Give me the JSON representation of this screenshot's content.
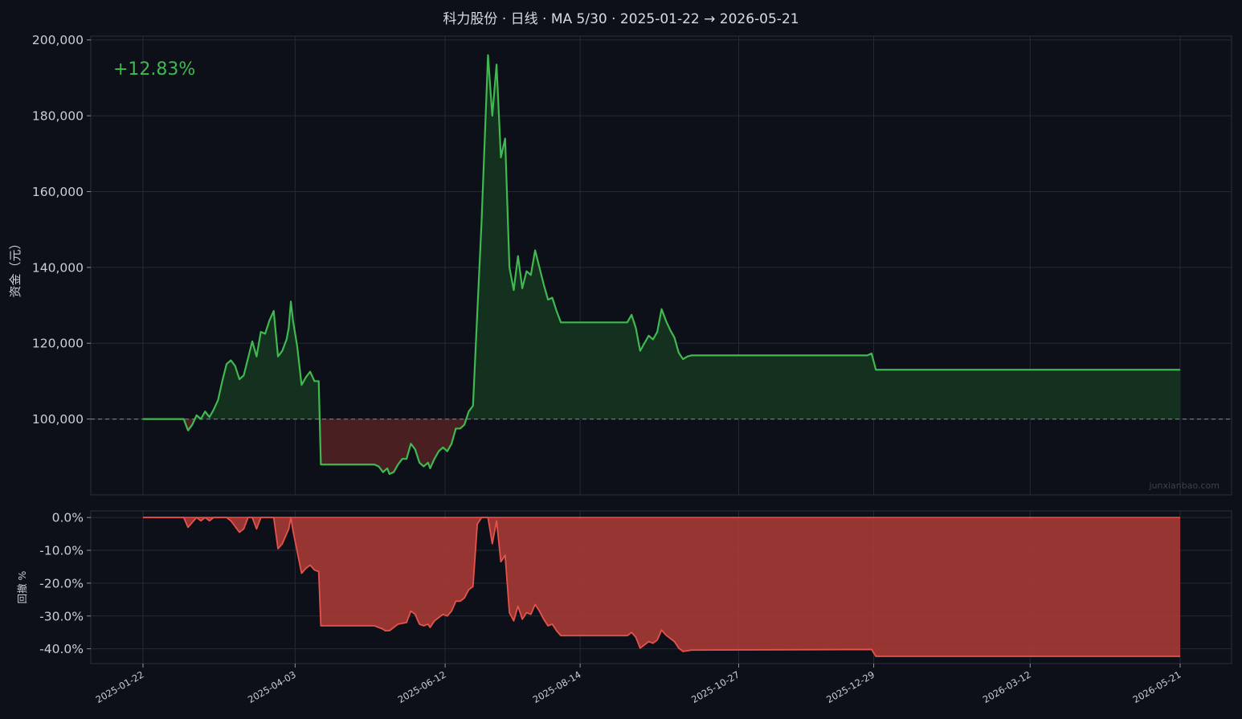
{
  "title": "科力股份 · 日线 · MA 5/30 · 2025-01-22 → 2026-05-21",
  "watermark": "junxianbao.com",
  "return_label": "+12.83%",
  "colors": {
    "background": "#0d1018",
    "panel": "#0d1018",
    "grid": "#252a34",
    "equity_line": "#3fb950",
    "equity_fill_up": "#14301f",
    "equity_fill_down": "#4a1f22",
    "drawdown_line": "#e5534b",
    "drawdown_fill": "#a63a36",
    "baseline": "#6e7681",
    "return_text": "#3fb950"
  },
  "chart_data": [
    {
      "type": "area",
      "name": "equity",
      "ylabel": "资金（元）",
      "ylim": [
        80000,
        201000
      ],
      "yticks": [
        100000,
        120000,
        140000,
        160000,
        180000,
        200000
      ],
      "ytick_labels": [
        "100,000",
        "120,000",
        "140,000",
        "160,000",
        "180,000",
        "200,000"
      ],
      "baseline": 100000,
      "grid": true,
      "x_start": "2025-01-22",
      "x_end": "2026-05-21",
      "xticks": [
        "2025-01-22",
        "2025-04-03",
        "2025-06-12",
        "2025-08-14",
        "2025-10-27",
        "2025-12-29",
        "2026-03-12",
        "2026-05-21"
      ],
      "points": [
        [
          "2025-01-22",
          100000
        ],
        [
          "2025-01-30",
          100000
        ],
        [
          "2025-02-07",
          100000
        ],
        [
          "2025-02-10",
          100000
        ],
        [
          "2025-02-12",
          97000
        ],
        [
          "2025-02-14",
          98500
        ],
        [
          "2025-02-16",
          101000
        ],
        [
          "2025-02-18",
          100000
        ],
        [
          "2025-02-20",
          102000
        ],
        [
          "2025-02-22",
          100500
        ],
        [
          "2025-02-24",
          102500
        ],
        [
          "2025-02-26",
          105000
        ],
        [
          "2025-02-28",
          110000
        ],
        [
          "2025-03-02",
          114500
        ],
        [
          "2025-03-04",
          115500
        ],
        [
          "2025-03-06",
          114000
        ],
        [
          "2025-03-08",
          110500
        ],
        [
          "2025-03-10",
          111500
        ],
        [
          "2025-03-12",
          116000
        ],
        [
          "2025-03-14",
          120500
        ],
        [
          "2025-03-16",
          116500
        ],
        [
          "2025-03-18",
          123000
        ],
        [
          "2025-03-20",
          122500
        ],
        [
          "2025-03-22",
          126000
        ],
        [
          "2025-03-24",
          128500
        ],
        [
          "2025-03-26",
          116500
        ],
        [
          "2025-03-28",
          118000
        ],
        [
          "2025-03-30",
          121000
        ],
        [
          "2025-03-31",
          124000
        ],
        [
          "2025-04-01",
          131000
        ],
        [
          "2025-04-02",
          126000
        ],
        [
          "2025-04-04",
          119000
        ],
        [
          "2025-04-06",
          109000
        ],
        [
          "2025-04-08",
          111000
        ],
        [
          "2025-04-10",
          112500
        ],
        [
          "2025-04-12",
          110000
        ],
        [
          "2025-04-14",
          110000
        ],
        [
          "2025-04-15",
          88000
        ],
        [
          "2025-04-20",
          88000
        ],
        [
          "2025-05-01",
          88000
        ],
        [
          "2025-05-10",
          88000
        ],
        [
          "2025-05-12",
          87500
        ],
        [
          "2025-05-14",
          86000
        ],
        [
          "2025-05-16",
          87000
        ],
        [
          "2025-05-17",
          85500
        ],
        [
          "2025-05-19",
          86000
        ],
        [
          "2025-05-21",
          88000
        ],
        [
          "2025-05-23",
          89500
        ],
        [
          "2025-05-25",
          89500
        ],
        [
          "2025-05-27",
          93500
        ],
        [
          "2025-05-29",
          92000
        ],
        [
          "2025-05-31",
          88500
        ],
        [
          "2025-06-02",
          87500
        ],
        [
          "2025-06-04",
          88500
        ],
        [
          "2025-06-05",
          87000
        ],
        [
          "2025-06-07",
          89500
        ],
        [
          "2025-06-09",
          91500
        ],
        [
          "2025-06-11",
          92500
        ],
        [
          "2025-06-13",
          91500
        ],
        [
          "2025-06-15",
          93500
        ],
        [
          "2025-06-17",
          97500
        ],
        [
          "2025-06-19",
          97500
        ],
        [
          "2025-06-21",
          98500
        ],
        [
          "2025-06-23",
          102000
        ],
        [
          "2025-06-25",
          103500
        ],
        [
          "2025-06-27",
          128000
        ],
        [
          "2025-06-29",
          152000
        ],
        [
          "2025-07-02",
          196000
        ],
        [
          "2025-07-04",
          180000
        ],
        [
          "2025-07-06",
          193500
        ],
        [
          "2025-07-08",
          169000
        ],
        [
          "2025-07-10",
          174000
        ],
        [
          "2025-07-12",
          140000
        ],
        [
          "2025-07-14",
          134000
        ],
        [
          "2025-07-16",
          143000
        ],
        [
          "2025-07-18",
          134500
        ],
        [
          "2025-07-20",
          139000
        ],
        [
          "2025-07-22",
          138000
        ],
        [
          "2025-07-24",
          144500
        ],
        [
          "2025-07-26",
          140000
        ],
        [
          "2025-07-28",
          135500
        ],
        [
          "2025-07-30",
          131500
        ],
        [
          "2025-08-01",
          132000
        ],
        [
          "2025-08-03",
          128500
        ],
        [
          "2025-08-05",
          125500
        ],
        [
          "2025-08-10",
          125500
        ],
        [
          "2025-08-20",
          125500
        ],
        [
          "2025-09-01",
          125500
        ],
        [
          "2025-09-05",
          125500
        ],
        [
          "2025-09-07",
          127500
        ],
        [
          "2025-09-09",
          124000
        ],
        [
          "2025-09-11",
          118000
        ],
        [
          "2025-09-13",
          120000
        ],
        [
          "2025-09-15",
          122000
        ],
        [
          "2025-09-17",
          121000
        ],
        [
          "2025-09-19",
          123000
        ],
        [
          "2025-09-21",
          129000
        ],
        [
          "2025-09-23",
          126000
        ],
        [
          "2025-09-25",
          123500
        ],
        [
          "2025-09-27",
          121500
        ],
        [
          "2025-09-29",
          117500
        ],
        [
          "2025-10-01",
          115800
        ],
        [
          "2025-10-03",
          116500
        ],
        [
          "2025-10-05",
          116800
        ],
        [
          "2025-10-15",
          116800
        ],
        [
          "2025-11-01",
          116800
        ],
        [
          "2025-11-20",
          116800
        ],
        [
          "2025-12-10",
          116800
        ],
        [
          "2025-12-26",
          116800
        ],
        [
          "2025-12-28",
          117300
        ],
        [
          "2025-12-30",
          113000
        ],
        [
          "2026-01-15",
          113000
        ],
        [
          "2026-02-10",
          113000
        ],
        [
          "2026-03-10",
          113000
        ],
        [
          "2026-04-10",
          113000
        ],
        [
          "2026-05-21",
          113000
        ]
      ]
    },
    {
      "type": "area",
      "name": "drawdown",
      "ylabel": "回撤 %",
      "ylim": [
        -44.5,
        2
      ],
      "yticks": [
        0,
        -10,
        -20,
        -30,
        -40
      ],
      "ytick_labels": [
        "0.0%",
        "-10.0%",
        "-20.0%",
        "-30.0%",
        "-40.0%"
      ],
      "grid": true,
      "x_start": "2025-01-22",
      "x_end": "2026-05-21",
      "xticks": [
        "2025-01-22",
        "2025-04-03",
        "2025-06-12",
        "2025-08-14",
        "2025-10-27",
        "2025-12-29",
        "2026-03-12",
        "2026-05-21"
      ],
      "points": [
        [
          "2025-01-22",
          0
        ],
        [
          "2025-02-10",
          0
        ],
        [
          "2025-02-12",
          -3
        ],
        [
          "2025-02-16",
          0
        ],
        [
          "2025-02-18",
          -1
        ],
        [
          "2025-02-20",
          0
        ],
        [
          "2025-02-22",
          -1
        ],
        [
          "2025-02-24",
          0
        ],
        [
          "2025-03-02",
          0
        ],
        [
          "2025-03-04",
          -1
        ],
        [
          "2025-03-08",
          -4.5
        ],
        [
          "2025-03-10",
          -3.5
        ],
        [
          "2025-03-12",
          0
        ],
        [
          "2025-03-14",
          0
        ],
        [
          "2025-03-16",
          -3.5
        ],
        [
          "2025-03-18",
          0
        ],
        [
          "2025-03-22",
          0
        ],
        [
          "2025-03-24",
          0
        ],
        [
          "2025-03-26",
          -9.5
        ],
        [
          "2025-03-28",
          -8
        ],
        [
          "2025-03-31",
          -3.5
        ],
        [
          "2025-04-01",
          0
        ],
        [
          "2025-04-02",
          -4
        ],
        [
          "2025-04-06",
          -17
        ],
        [
          "2025-04-08",
          -15.5
        ],
        [
          "2025-04-10",
          -14.5
        ],
        [
          "2025-04-12",
          -16
        ],
        [
          "2025-04-14",
          -16.5
        ],
        [
          "2025-04-15",
          -33
        ],
        [
          "2025-05-10",
          -33
        ],
        [
          "2025-05-14",
          -34
        ],
        [
          "2025-05-15",
          -34.5
        ],
        [
          "2025-05-17",
          -34.5
        ],
        [
          "2025-05-21",
          -32.5
        ],
        [
          "2025-05-25",
          -32
        ],
        [
          "2025-05-27",
          -28.5
        ],
        [
          "2025-05-29",
          -29.5
        ],
        [
          "2025-05-31",
          -32.5
        ],
        [
          "2025-06-02",
          -33
        ],
        [
          "2025-06-04",
          -32.5
        ],
        [
          "2025-06-05",
          -33.5
        ],
        [
          "2025-06-07",
          -31.5
        ],
        [
          "2025-06-11",
          -29.5
        ],
        [
          "2025-06-13",
          -30
        ],
        [
          "2025-06-15",
          -28.5
        ],
        [
          "2025-06-17",
          -25.5
        ],
        [
          "2025-06-19",
          -25.5
        ],
        [
          "2025-06-21",
          -24.5
        ],
        [
          "2025-06-23",
          -22
        ],
        [
          "2025-06-25",
          -21
        ],
        [
          "2025-06-27",
          -2
        ],
        [
          "2025-06-29",
          0
        ],
        [
          "2025-07-02",
          0
        ],
        [
          "2025-07-04",
          -8
        ],
        [
          "2025-07-06",
          -1
        ],
        [
          "2025-07-08",
          -13.5
        ],
        [
          "2025-07-10",
          -11.5
        ],
        [
          "2025-07-12",
          -29
        ],
        [
          "2025-07-14",
          -31.5
        ],
        [
          "2025-07-16",
          -27
        ],
        [
          "2025-07-18",
          -31
        ],
        [
          "2025-07-20",
          -29
        ],
        [
          "2025-07-22",
          -29.5
        ],
        [
          "2025-07-24",
          -26.5
        ],
        [
          "2025-07-26",
          -28.5
        ],
        [
          "2025-07-28",
          -31
        ],
        [
          "2025-07-30",
          -33
        ],
        [
          "2025-08-01",
          -32.5
        ],
        [
          "2025-08-03",
          -34.5
        ],
        [
          "2025-08-05",
          -36
        ],
        [
          "2025-09-05",
          -36
        ],
        [
          "2025-09-07",
          -35
        ],
        [
          "2025-09-09",
          -36.5
        ],
        [
          "2025-09-11",
          -39.8
        ],
        [
          "2025-09-13",
          -38.8
        ],
        [
          "2025-09-15",
          -37.8
        ],
        [
          "2025-09-17",
          -38.3
        ],
        [
          "2025-09-19",
          -37.3
        ],
        [
          "2025-09-21",
          -34.3
        ],
        [
          "2025-09-23",
          -35.8
        ],
        [
          "2025-09-25",
          -36.8
        ],
        [
          "2025-09-27",
          -37.8
        ],
        [
          "2025-09-29",
          -39.8
        ],
        [
          "2025-10-01",
          -40.8
        ],
        [
          "2025-10-05",
          -40.4
        ],
        [
          "2025-12-28",
          -40.2
        ],
        [
          "2025-12-30",
          -42.3
        ],
        [
          "2026-05-21",
          -42.3
        ]
      ]
    }
  ]
}
